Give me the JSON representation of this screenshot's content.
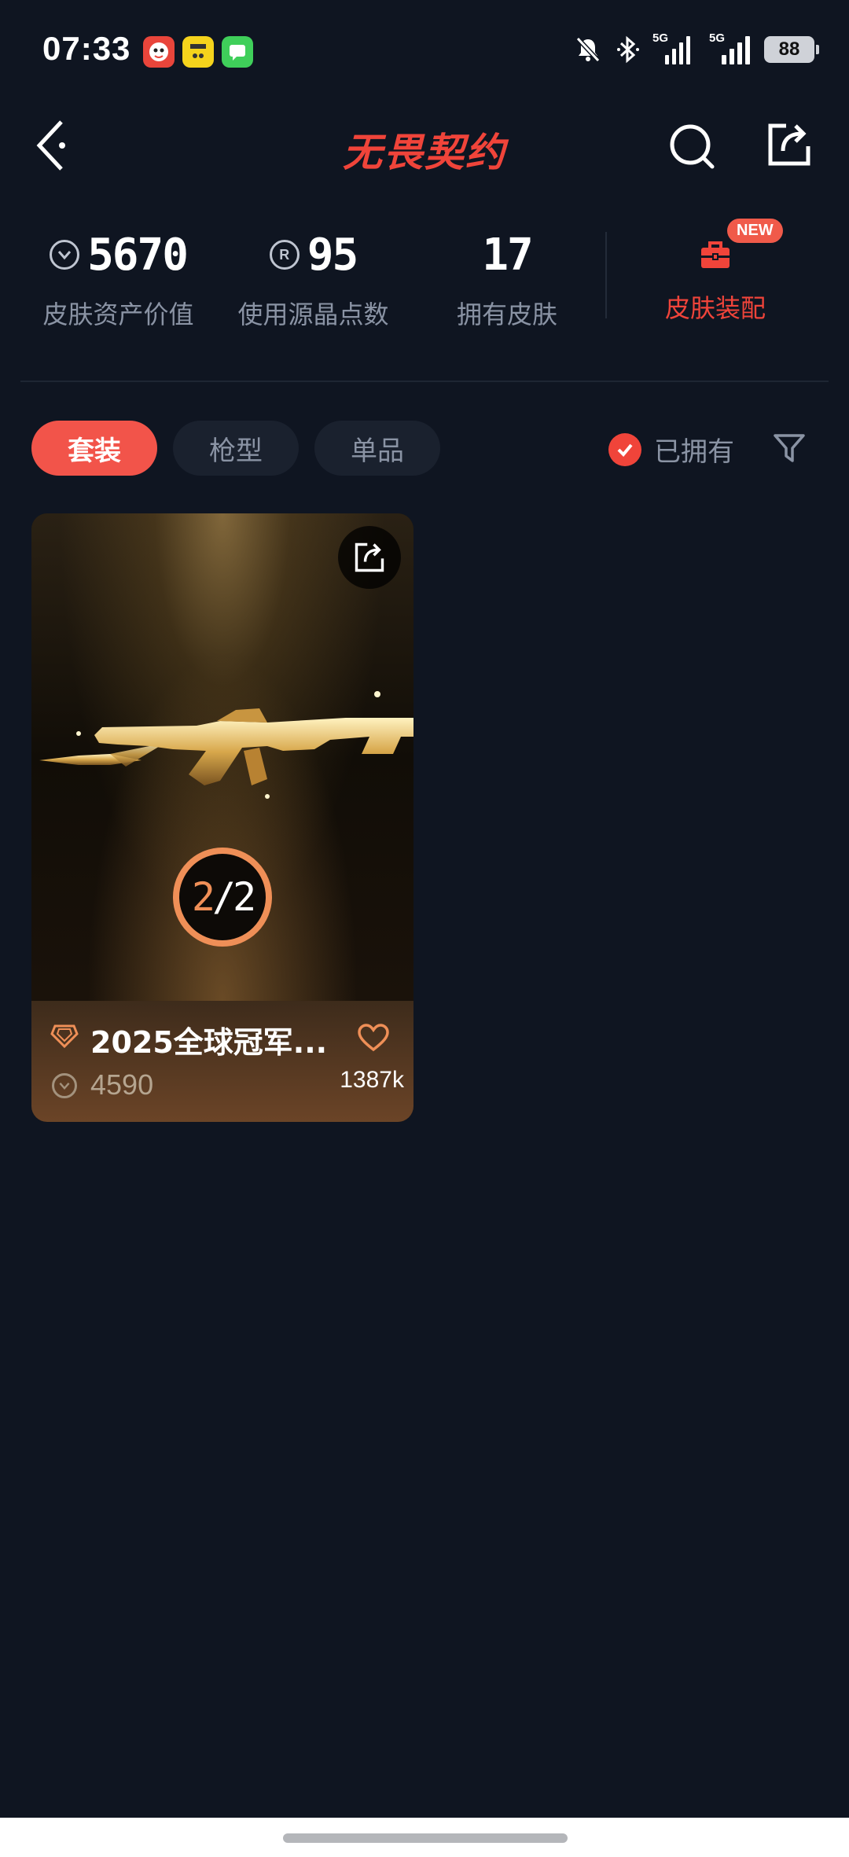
{
  "status_bar": {
    "time": "07:33",
    "network_1": "5G",
    "network_2": "5G",
    "battery": "88",
    "app_icons": [
      "app-icon-mascot",
      "app-icon-yellow",
      "app-icon-message"
    ]
  },
  "header": {
    "logo_text": "无畏契约"
  },
  "stats": {
    "skin_value": "5670",
    "skin_value_label": "皮肤资产价值",
    "crystal_points": "95",
    "crystal_points_label": "使用源晶点数",
    "skins_owned": "17",
    "skins_owned_label": "拥有皮肤",
    "equip_label": "皮肤装配",
    "new_badge": "NEW"
  },
  "tabs": [
    {
      "label": "套装",
      "active": true
    },
    {
      "label": "枪型",
      "active": false
    },
    {
      "label": "单品",
      "active": false
    }
  ],
  "filter": {
    "owned_label": "已拥有",
    "owned_checked": true
  },
  "card": {
    "count_current": "2",
    "count_sep": "/",
    "count_total": "2",
    "title": "2025全球冠军...",
    "price": "4590",
    "likes": "1387k"
  },
  "colors": {
    "accent": "#f0443a",
    "background": "#0f1521",
    "badge_orange": "#ef8f57"
  }
}
